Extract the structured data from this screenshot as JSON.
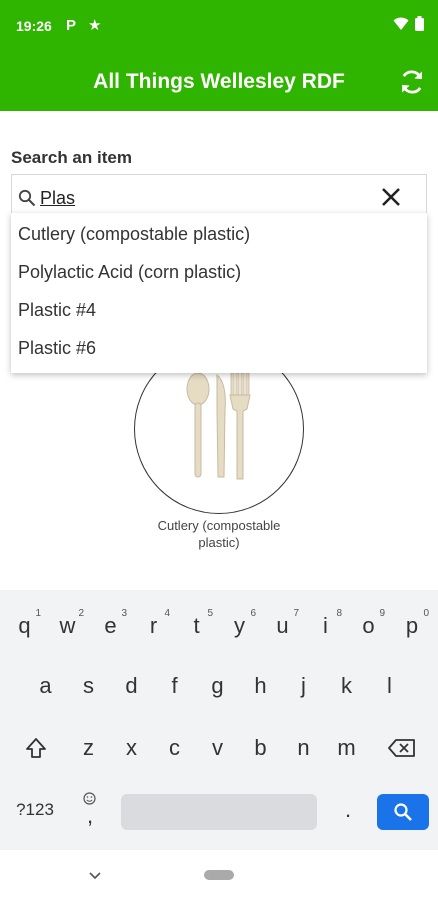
{
  "status": {
    "time": "19:26",
    "p_icon": "P"
  },
  "app": {
    "title": "All Things Wellesley RDF"
  },
  "search": {
    "label": "Search an item",
    "value": "Plas"
  },
  "suggestions": [
    "Cutlery (compostable plastic)",
    "Polylactic Acid (corn plastic)",
    "Plastic #4",
    "Plastic #6"
  ],
  "item": {
    "caption": "Cutlery (compostable plastic)"
  },
  "keyboard": {
    "row1": [
      {
        "k": "q",
        "n": "1"
      },
      {
        "k": "w",
        "n": "2"
      },
      {
        "k": "e",
        "n": "3"
      },
      {
        "k": "r",
        "n": "4"
      },
      {
        "k": "t",
        "n": "5"
      },
      {
        "k": "y",
        "n": "6"
      },
      {
        "k": "u",
        "n": "7"
      },
      {
        "k": "i",
        "n": "8"
      },
      {
        "k": "o",
        "n": "9"
      },
      {
        "k": "p",
        "n": "0"
      }
    ],
    "row2": [
      "a",
      "s",
      "d",
      "f",
      "g",
      "h",
      "j",
      "k",
      "l"
    ],
    "row3": [
      "z",
      "x",
      "c",
      "v",
      "b",
      "n",
      "m"
    ],
    "symbols": "?123",
    "comma": ",",
    "period": "."
  },
  "colors": {
    "brand_green": "#2fb400",
    "search_key_blue": "#1a73e8"
  }
}
